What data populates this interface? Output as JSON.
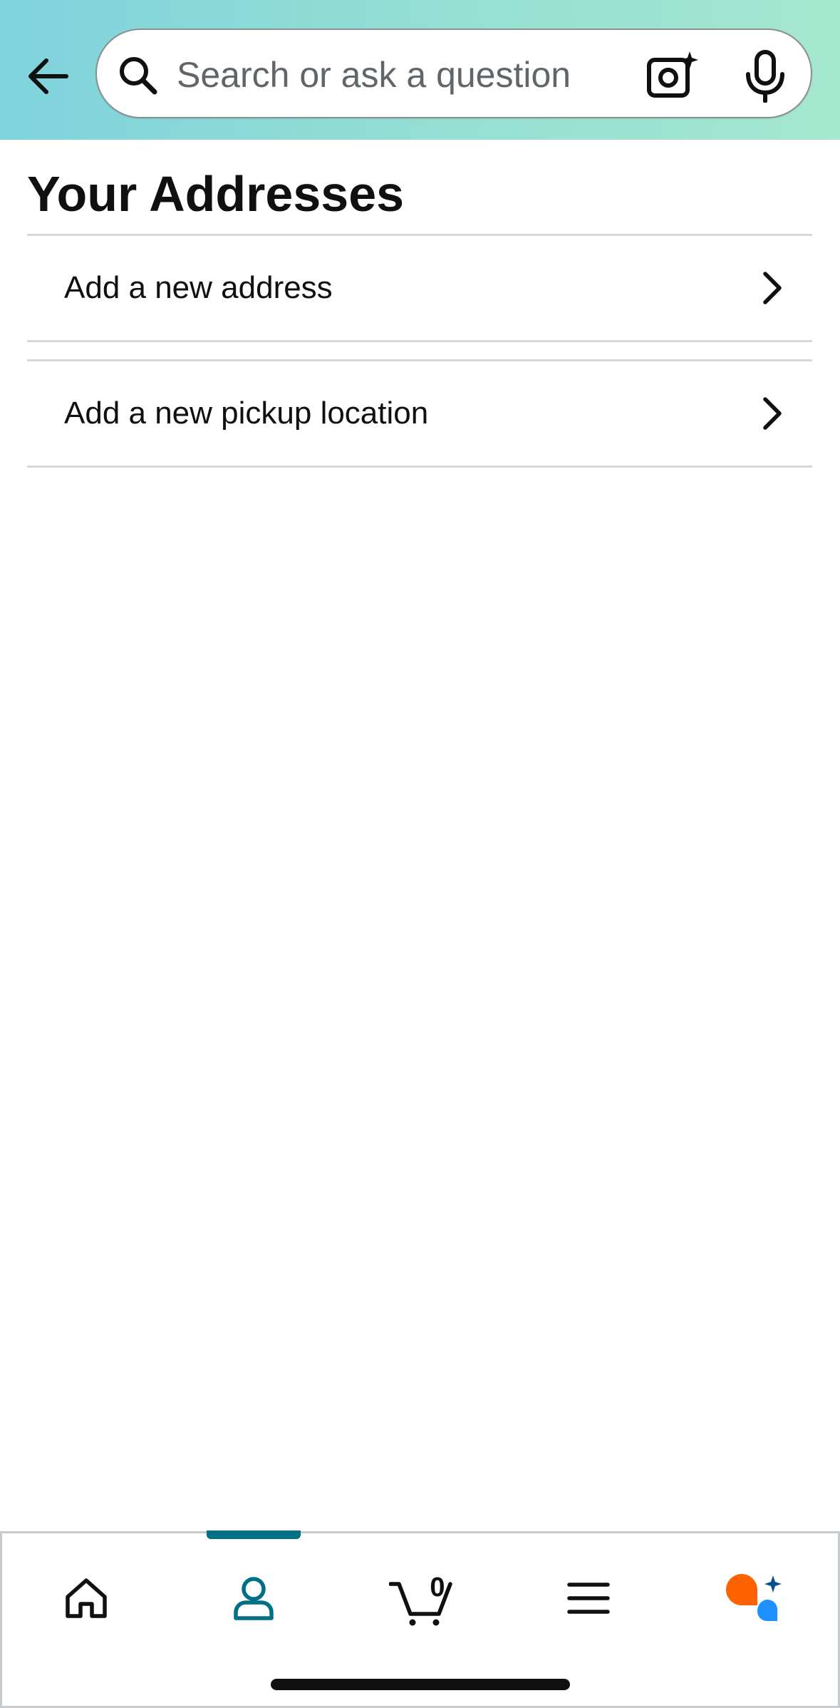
{
  "header": {
    "search_placeholder": "Search or ask a question",
    "icons": {
      "back": "arrow-left-icon",
      "search": "magnifier-icon",
      "camera": "camera-sparkle-icon",
      "mic": "microphone-icon"
    }
  },
  "page": {
    "title": "Your Addresses"
  },
  "address_options": [
    {
      "label": "Add a new address"
    },
    {
      "label": "Add a new pickup location"
    }
  ],
  "bottom_nav": {
    "active": "account",
    "accent_color": "#007185",
    "cart_count": "0",
    "items": [
      "home-icon",
      "account-icon",
      "cart-icon",
      "menu-icon",
      "assistant-icon"
    ]
  },
  "colors": {
    "header_gradient_start": "#7fd3dd",
    "header_gradient_end": "#a6e7cf",
    "divider": "#d5d9d9",
    "assistant_orange": "#ff6200",
    "assistant_blue": "#1e90ff"
  }
}
